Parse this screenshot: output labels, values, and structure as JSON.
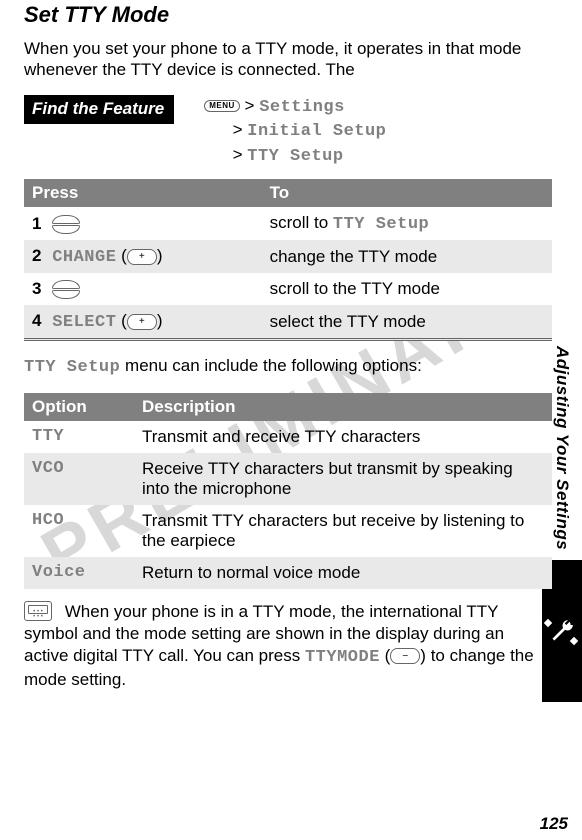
{
  "watermark": "PRELIMINARY",
  "title": "Set TTY Mode",
  "intro": "When you set your phone to a TTY mode, it operates in that mode whenever the TTY device is connected. The",
  "feature": {
    "label": "Find the Feature",
    "menu_key": "MENU",
    "gt": ">",
    "path1": "Settings",
    "path2": "Initial Setup",
    "path3": "TTY Setup"
  },
  "steps": {
    "h_press": "Press",
    "h_to": "To",
    "rows": [
      {
        "n": "1",
        "press_code": "scroll",
        "to": "scroll to",
        "to_code": "TTY Setup"
      },
      {
        "n": "2",
        "press_label": "CHANGE",
        "press_key": "+",
        "to": "change the TTY mode",
        "to_code": ""
      },
      {
        "n": "3",
        "press_code": "scroll",
        "to": "scroll to the TTY mode",
        "to_code": ""
      },
      {
        "n": "4",
        "press_label": "SELECT",
        "press_key": "+",
        "to": "select the TTY mode",
        "to_code": ""
      }
    ]
  },
  "options_intro_prefix": "TTY Setup",
  "options_intro_rest": " menu can include the following options:",
  "options": {
    "h_option": "Option",
    "h_desc": "Description",
    "rows": [
      {
        "opt": "TTY",
        "desc": "Transmit and receive TTY characters"
      },
      {
        "opt": "VCO",
        "desc": "Receive TTY characters but transmit by speaking into the microphone"
      },
      {
        "opt": "HCO",
        "desc": "Transmit TTY characters but receive by listening to the earpiece"
      },
      {
        "opt": "Voice",
        "desc": "Return to normal voice mode"
      }
    ]
  },
  "closing": {
    "p1": "When your phone is in a TTY mode, the international TTY symbol and the mode setting are shown in the display during an active digital TTY call. You can press ",
    "code": "TTYMODE",
    "key": "−",
    "p2": " to change the mode setting."
  },
  "side_label": "Adjusting Your Settings",
  "page_number": "125"
}
